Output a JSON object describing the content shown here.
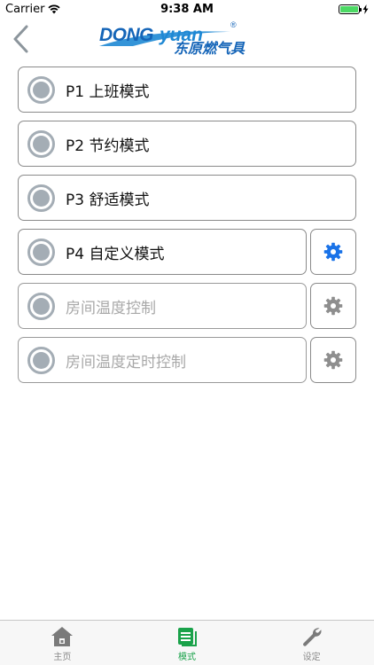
{
  "status_bar": {
    "carrier": "Carrier",
    "time": "9:38 AM",
    "battery_level": 1.0
  },
  "nav": {
    "logo_text": "DONGyuan",
    "logo_cn": "东原燃气具",
    "logo_mark": "®"
  },
  "modes": [
    {
      "label": "P1 上班模式",
      "enabled": true,
      "has_settings": false
    },
    {
      "label": "P2 节约模式",
      "enabled": true,
      "has_settings": false
    },
    {
      "label": "P3 舒适模式",
      "enabled": true,
      "has_settings": false
    },
    {
      "label": "P4 自定义模式",
      "enabled": true,
      "has_settings": true
    },
    {
      "label": "房间温度控制",
      "enabled": false,
      "has_settings": true
    },
    {
      "label": "房间温度定时控制",
      "enabled": false,
      "has_settings": true
    }
  ],
  "tabs": [
    {
      "label": "主页",
      "icon": "home-icon"
    },
    {
      "label": "模式",
      "icon": "mode-list-icon",
      "active": true
    },
    {
      "label": "设定",
      "icon": "wrench-icon"
    }
  ],
  "colors": {
    "accent_blue": "#1a73e8",
    "disabled_gray": "#8e8e8e",
    "active_green": "#1aa24a",
    "radio_gray": "#a4adb5"
  }
}
